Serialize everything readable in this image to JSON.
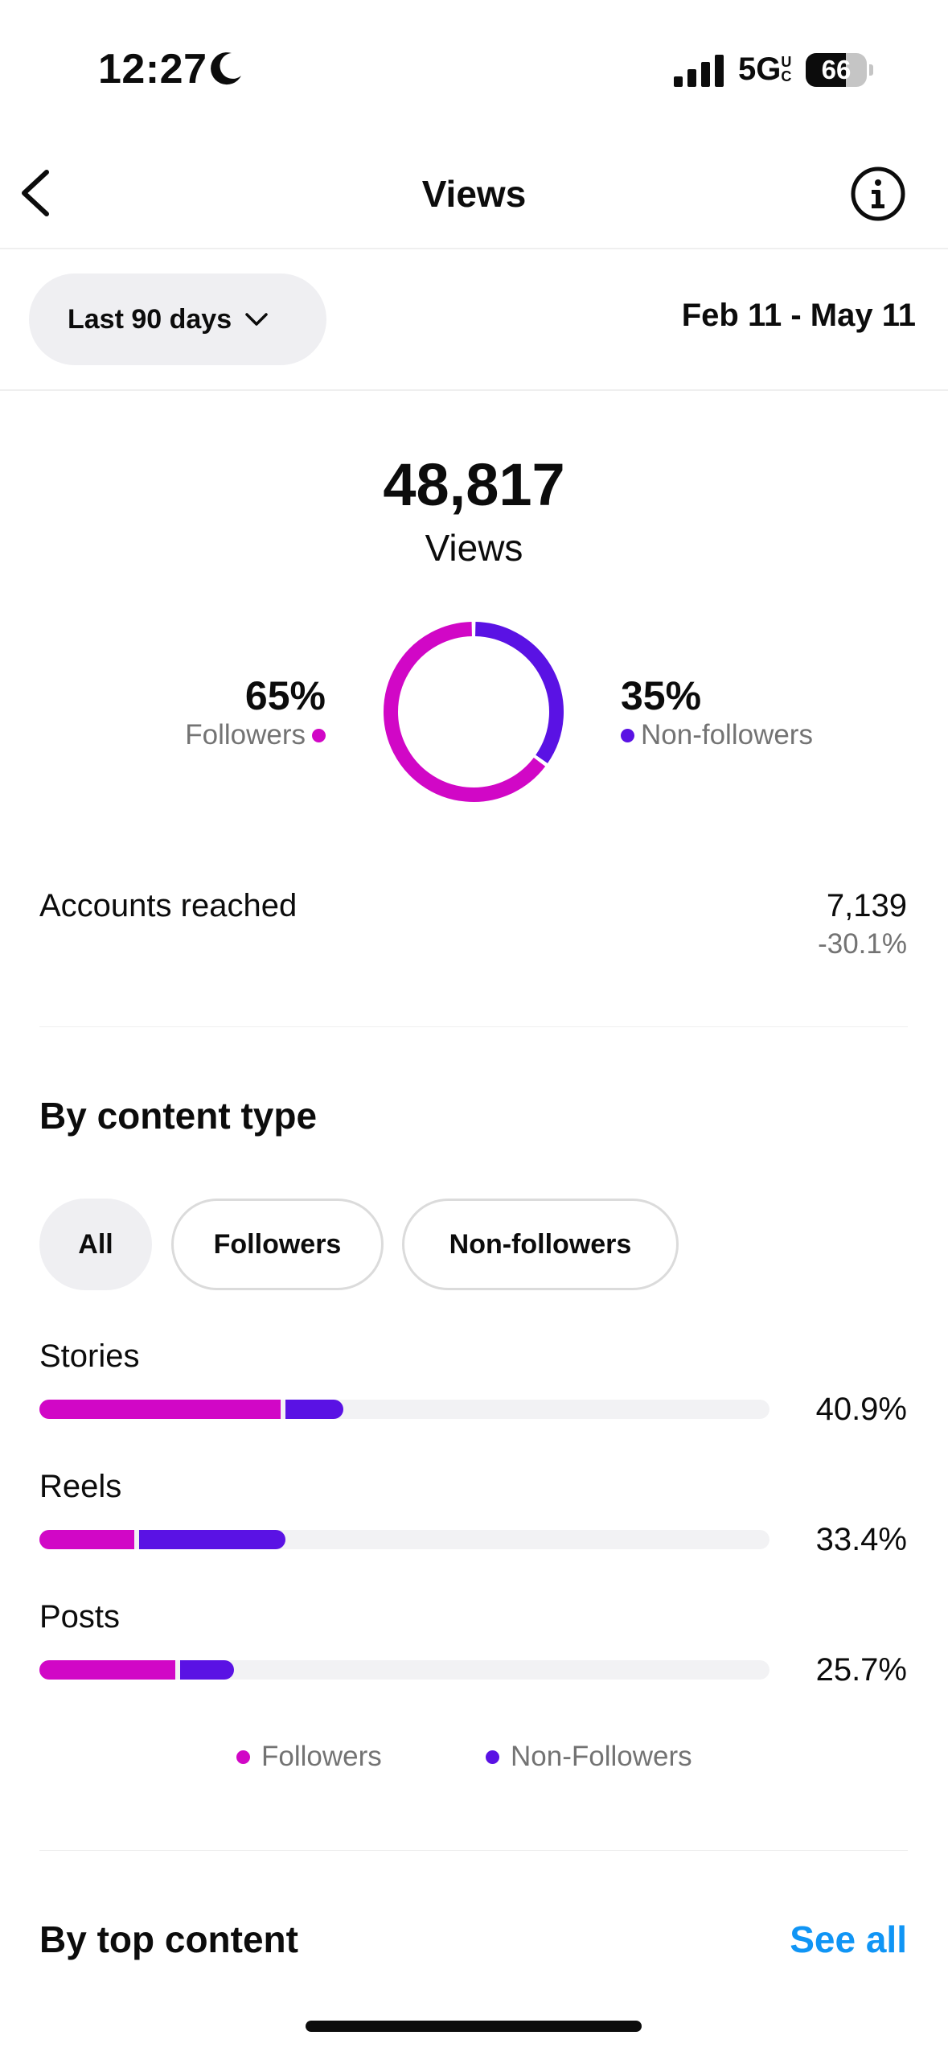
{
  "status_bar": {
    "time": "12:27",
    "network": "5G",
    "network_suffix": "UC",
    "battery": "66",
    "battery_level": 0.66
  },
  "header": {
    "title": "Views",
    "back_icon": "chevron-left-icon",
    "info_icon": "info-icon"
  },
  "range": {
    "selected": "Last 90 days",
    "dates": "Feb 11 - May 11"
  },
  "summary": {
    "total": "48,817",
    "total_label": "Views",
    "followers_pct": "65%",
    "followers_label": "Followers",
    "non_followers_pct": "35%",
    "non_followers_label": "Non-followers",
    "followers_share": 0.65,
    "non_followers_share": 0.35
  },
  "accounts_reached": {
    "label": "Accounts reached",
    "value": "7,139",
    "change": "-30.1%"
  },
  "content_type": {
    "heading": "By content type",
    "filters": [
      "All",
      "Followers",
      "Non-followers"
    ],
    "selected_filter": "All",
    "rows": [
      {
        "label": "Stories",
        "percent": "40.9%",
        "followers": 0.33,
        "non_followers": 0.08
      },
      {
        "label": "Reels",
        "percent": "33.4%",
        "followers": 0.13,
        "non_followers": 0.2
      },
      {
        "label": "Posts",
        "percent": "25.7%",
        "followers": 0.186,
        "non_followers": 0.074
      }
    ],
    "legend": {
      "followers": "Followers",
      "non_followers": "Non-Followers"
    }
  },
  "top_content": {
    "heading": "By top content",
    "see_all": "See all"
  },
  "colors": {
    "followers": "#d107c6",
    "non_followers": "#5a12e4",
    "link": "#1095f5",
    "secondary_text": "#737373"
  }
}
